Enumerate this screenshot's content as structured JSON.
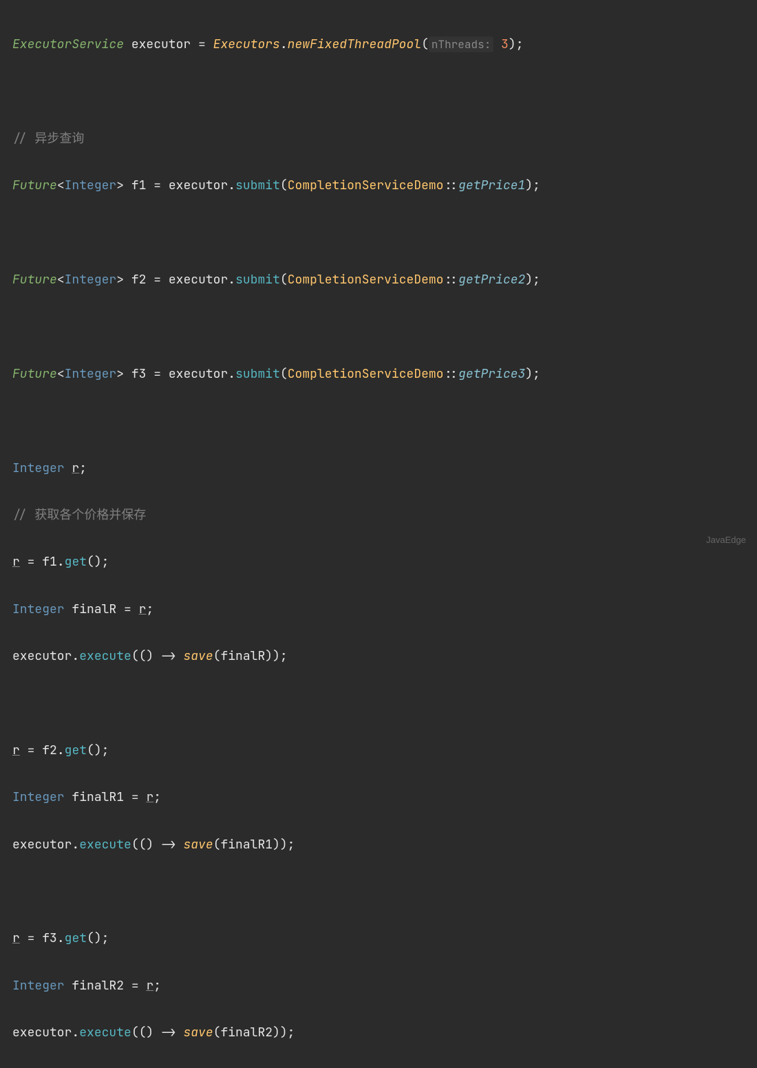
{
  "line1": {
    "type1": "ExecutorService",
    "var1": "executor",
    "eq": "=",
    "cls": "Executors",
    "dot": ".",
    "method": "newFixedThreadPool",
    "open": "(",
    "hint": "nThreads:",
    "sp": " ",
    "num": "3",
    "close": ")",
    "semi": ";"
  },
  "comment1": "// 异步查询",
  "future1": {
    "type": "Future",
    "lt": "<",
    "generic": "Integer",
    "gt": ">",
    "sp": " ",
    "var": "f1",
    "eq": " = ",
    "exec": "executor",
    "dot": ".",
    "method": "submit",
    "open": "(",
    "cls": "CompletionServiceDemo",
    "dcolon": "::",
    "ref": "getPrice1",
    "close": ")",
    "semi": ";"
  },
  "future2": {
    "type": "Future",
    "lt": "<",
    "generic": "Integer",
    "gt": ">",
    "sp": " ",
    "var": "f2",
    "eq": " = ",
    "exec": "executor",
    "dot": ".",
    "method": "submit",
    "open": "(",
    "cls": "CompletionServiceDemo",
    "dcolon": "::",
    "ref": "getPrice2",
    "close": ")",
    "semi": ";"
  },
  "future3": {
    "type": "Future",
    "lt": "<",
    "generic": "Integer",
    "gt": ">",
    "sp": " ",
    "var": "f3",
    "eq": " = ",
    "exec": "executor",
    "dot": ".",
    "method": "submit",
    "open": "(",
    "cls": "CompletionServiceDemo",
    "dcolon": "::",
    "ref": "getPrice3",
    "close": ")",
    "semi": ";"
  },
  "declR": {
    "type": "Integer",
    "sp": " ",
    "var": "r",
    "semi": ";"
  },
  "comment2": "// 获取各个价格并保存",
  "block1": {
    "r": "r",
    "eq": " = ",
    "f": "f1",
    "dot": ".",
    "get": "get",
    "p": "()",
    "semi": ";",
    "int": "Integer",
    "final": "finalR",
    "eq2": " = ",
    "r2": "r",
    "semi2": ";",
    "exec": "executor",
    "dot2": ".",
    "execm": "execute",
    "open": "(() -> ",
    "save": "save",
    "pp": "(",
    "arg": "finalR",
    "close": "));"
  },
  "block2": {
    "r": "r",
    "eq": " = ",
    "f": "f2",
    "dot": ".",
    "get": "get",
    "p": "()",
    "semi": ";",
    "int": "Integer",
    "final": "finalR1",
    "eq2": " = ",
    "r2": "r",
    "semi2": ";",
    "exec": "executor",
    "dot2": ".",
    "execm": "execute",
    "open": "(() -> ",
    "save": "save",
    "pp": "(",
    "arg": "finalR1",
    "close": "));"
  },
  "block3": {
    "r": "r",
    "eq": " = ",
    "f": "f3",
    "dot": ".",
    "get": "get",
    "p": "()",
    "semi": ";",
    "int": "Integer",
    "final": "finalR2",
    "eq2": " = ",
    "r2": "r",
    "semi2": ";",
    "exec": "executor",
    "dot2": ".",
    "execm": "execute",
    "open": "(() -> ",
    "save": "save",
    "pp": "(",
    "arg": "finalR2",
    "close": "));"
  },
  "watermark": "JavaEdge"
}
